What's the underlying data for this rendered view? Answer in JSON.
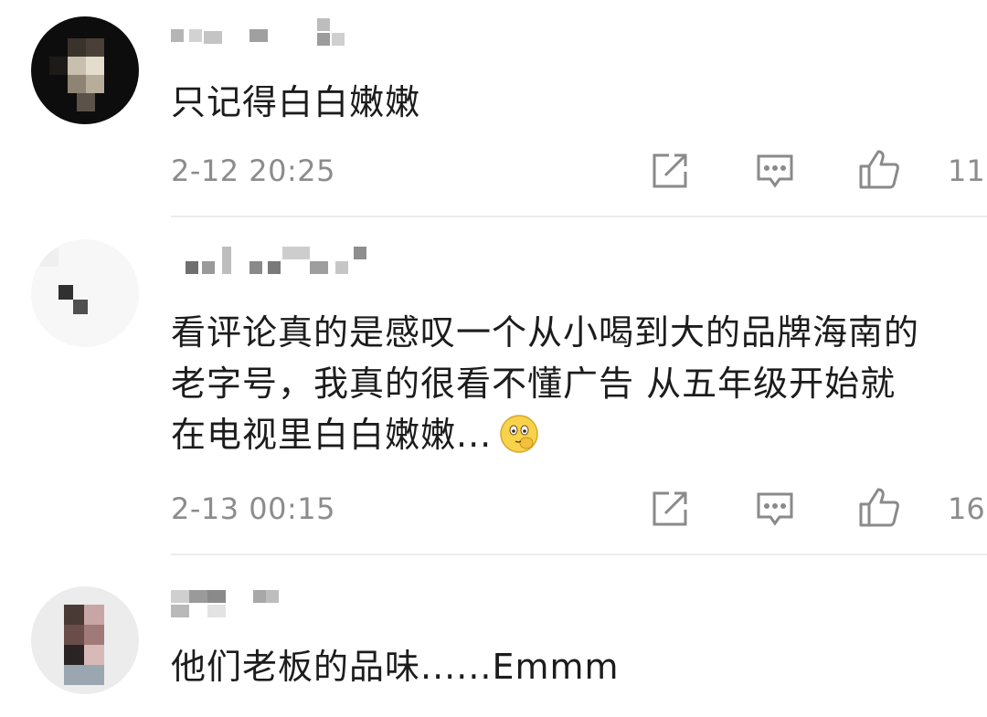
{
  "comments": [
    {
      "text": "只记得白白嫩嫩",
      "time": "2-12 20:25",
      "likes": "11"
    },
    {
      "text": "看评论真的是感叹一个从小喝到大的品牌海南的老字号，我真的很看不懂广告 从五年级开始就在电视里白白嫩嫩...",
      "emoji": "shy-face-emoji",
      "time": "2-13 00:15",
      "likes": "16"
    },
    {
      "text": "他们老板的品味......Emmm"
    }
  ],
  "icons": {
    "share": "share-icon",
    "reply": "comment-icon",
    "like": "thumbs-up-icon"
  },
  "colors": {
    "meta_text": "#8c8c8c",
    "icon_stroke": "#8a8a8a",
    "divider": "#ececec"
  }
}
